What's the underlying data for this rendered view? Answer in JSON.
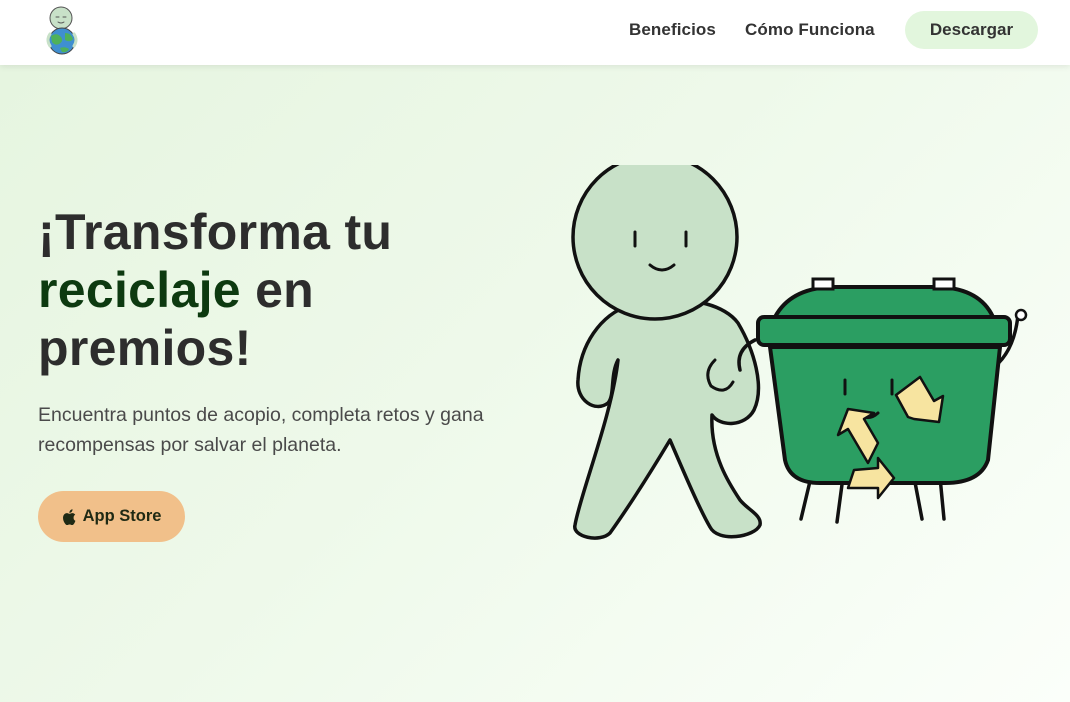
{
  "nav": {
    "logo_icon": "earth-mascot-logo-icon",
    "links": [
      {
        "label": "Beneficios"
      },
      {
        "label": "Cómo Funciona"
      }
    ],
    "download_label": "Descargar"
  },
  "hero": {
    "title_part1": "¡Transforma tu",
    "title_accent": "reciclaje",
    "title_part2": "en premios!",
    "subtitle": "Encuentra puntos de acopio, completa retos y gana recompensas por salvar el planeta.",
    "app_store_label": "App Store",
    "app_store_icon": "apple-icon",
    "illustration_icons": [
      "green-mascot-icon",
      "recycling-bin-mascot-icon",
      "recycle-symbol-icon"
    ]
  },
  "colors": {
    "accent_dark_green": "#0d3a10",
    "nav_download_bg": "#e2f6dd",
    "app_store_bg": "#f1c08a",
    "mascot_green": "#c8e1c8",
    "bin_green": "#2b9e62",
    "recycle_yellow": "#f7e4a0"
  }
}
